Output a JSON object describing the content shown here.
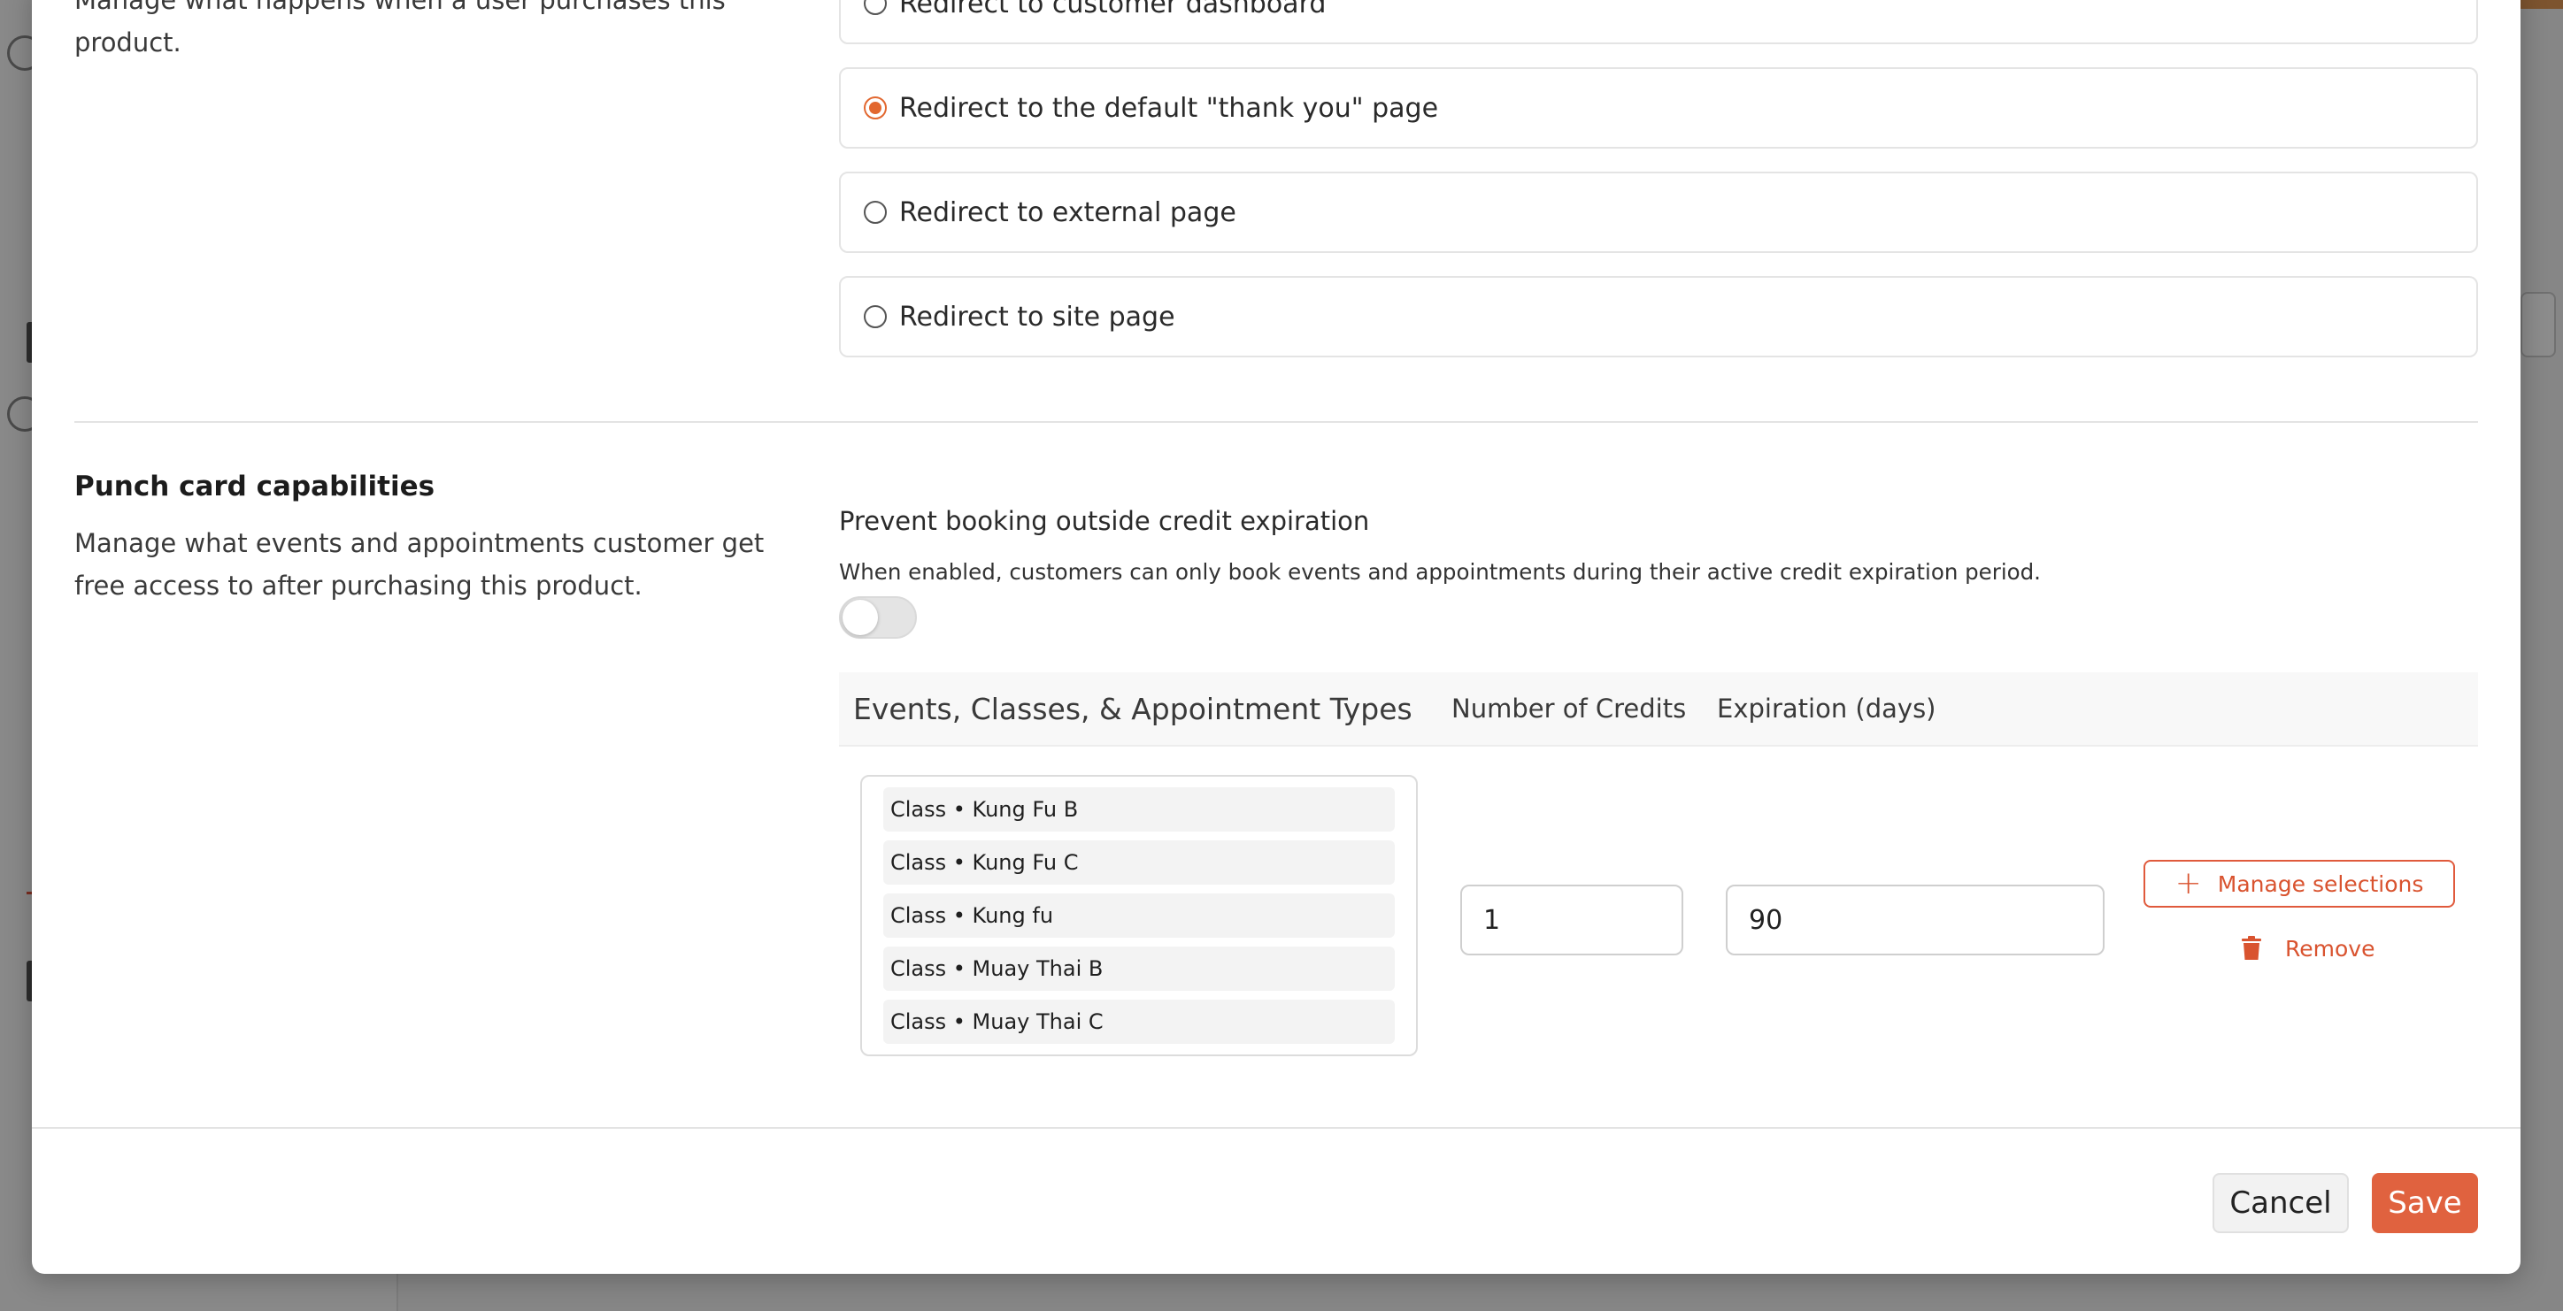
{
  "purchase": {
    "description": "Manage what happens when a user purchases this product.",
    "options": [
      {
        "label": "Redirect to customer dashboard",
        "checked": false
      },
      {
        "label": "Redirect to the default \"thank you\" page",
        "checked": true
      },
      {
        "label": "Redirect to external page",
        "checked": false
      },
      {
        "label": "Redirect to site page",
        "checked": false
      }
    ]
  },
  "punch_card": {
    "title": "Punch card capabilities",
    "description": "Manage what events and appointments customer get free access to after purchasing this product.",
    "toggle_title": "Prevent booking outside credit expiration",
    "toggle_help": "When enabled, customers can only book events and appointments during their active credit expiration period.",
    "toggle_on": false,
    "columns": {
      "types": "Events, Classes, & Appointment Types",
      "credits": "Number of Credits",
      "expiration": "Expiration (days)"
    },
    "row": {
      "selections": [
        "Class • Kung Fu B",
        "Class • Kung Fu C",
        "Class • Kung fu",
        "Class • Muay Thai B",
        "Class • Muay Thai C"
      ],
      "credits": "1",
      "expiration": "90",
      "manage_label": "Manage selections",
      "remove_label": "Remove"
    }
  },
  "footer": {
    "cancel_label": "Cancel",
    "save_label": "Save"
  },
  "colors": {
    "accent": "#e0623f",
    "radio_checked": "#e2672f",
    "overlay": "#000000"
  },
  "icons": {
    "manage": "plus-icon",
    "remove": "trash-icon"
  }
}
